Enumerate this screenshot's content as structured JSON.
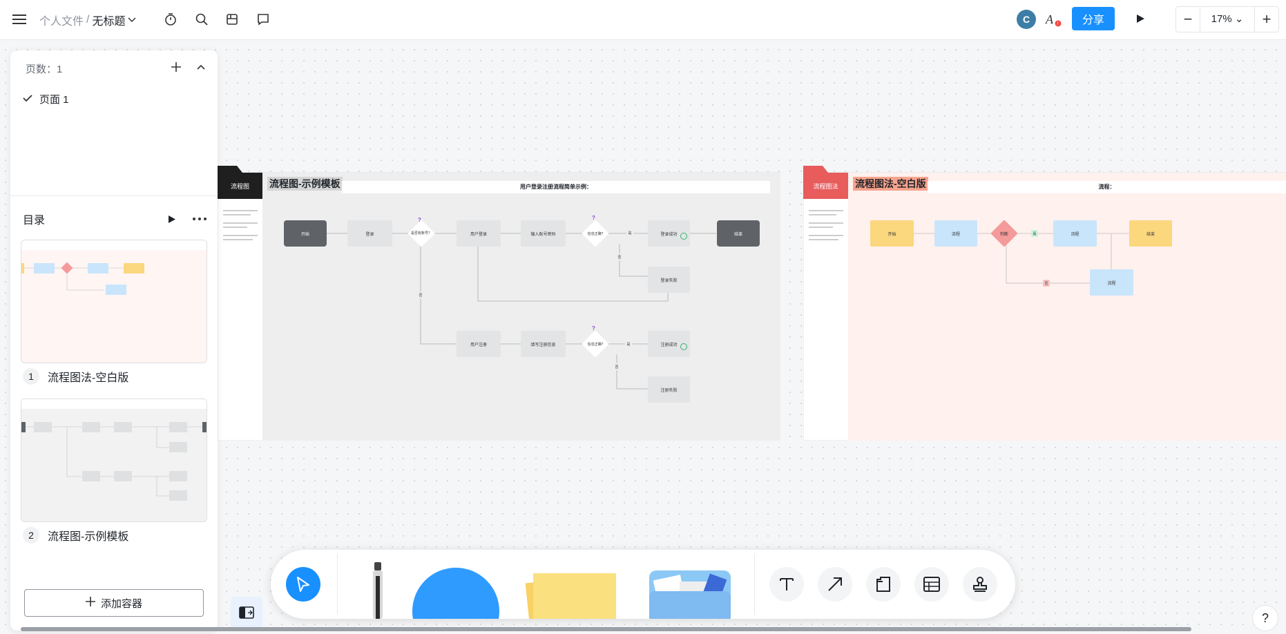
{
  "header": {
    "menu_icon": "hamburger-icon",
    "breadcrumb_parent": "个人文件",
    "breadcrumb_sep": "/",
    "doc_title": "无标题",
    "icons": [
      "timer-icon",
      "search-icon",
      "archive-icon",
      "comment-icon"
    ],
    "avatar_letter": "C",
    "share_label": "分享",
    "zoom_minus": "−",
    "zoom_level": "17%",
    "zoom_plus": "+"
  },
  "pages": {
    "count_label": "页数：1",
    "items": [
      {
        "label": "页面 1",
        "selected": true
      }
    ]
  },
  "toc": {
    "title": "目录",
    "items": [
      {
        "num": "1",
        "label": "流程图法-空白版"
      },
      {
        "num": "2",
        "label": "流程图-示例模板"
      }
    ],
    "add_label": "添加容器"
  },
  "board1": {
    "tag": "流程图",
    "title": "流程图-示例模板",
    "subtitle": "用户登录注册流程简单示例：",
    "nodes": {
      "start": "开始",
      "login": "登录",
      "decide": "是否有账号？",
      "user_login": "用户登录",
      "input_pw": "输入账号密码",
      "check": "信息正确?",
      "yes1": "是",
      "success": "登录成功",
      "end": "结束",
      "no1": "否",
      "fail": "登录失败",
      "no_acct": "否",
      "register": "用户注册",
      "fill": "填写注册信息",
      "check2": "信息正确?",
      "yes2": "是",
      "reg_ok": "注册成功",
      "no2": "否",
      "reg_fail": "注册失败"
    }
  },
  "board2": {
    "tag": "流程图法",
    "title": "流程图法-空白版",
    "subtitle": "流程：",
    "nodes": {
      "start": "开始",
      "step1": "流程",
      "decide": "判断",
      "yes": "是",
      "step2": "流程",
      "end": "结束",
      "no": "否",
      "step3": "流程"
    }
  },
  "colors": {
    "accent": "#1890ff",
    "board2_bg": "#fff1ee",
    "board2_tag": "#e85c5c",
    "node_blue": "#c9e5fb",
    "node_yellow": "#fbd77e",
    "node_red": "#f59a9a"
  }
}
